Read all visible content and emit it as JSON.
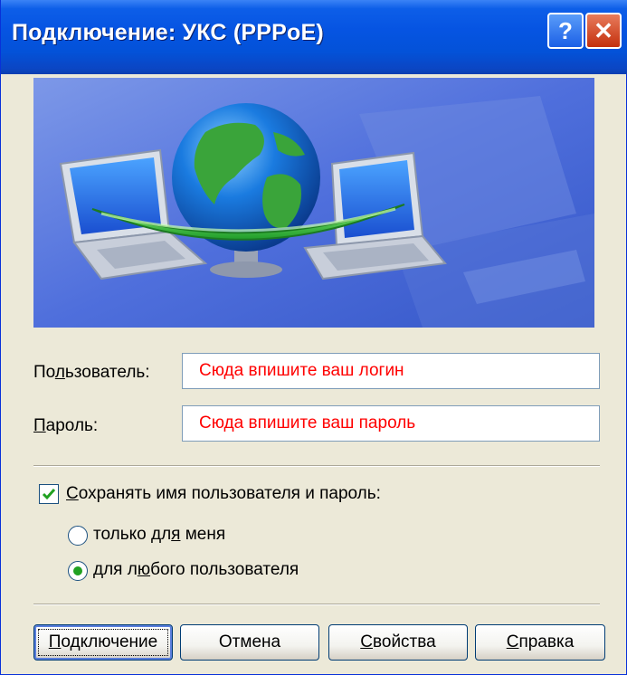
{
  "window": {
    "title": "Подключение: УКС (PPPoE)",
    "help_glyph": "?",
    "close_glyph": "✕"
  },
  "form": {
    "user_label_prefix": "По",
    "user_label_key": "л",
    "user_label_rest": "ьзователь:",
    "user_value": "Сюда впишите ваш логин",
    "password_label_prefix": "",
    "password_label_key": "П",
    "password_label_rest": "ароль:",
    "password_value": "Сюда впишите ваш пароль"
  },
  "save": {
    "checked": true,
    "label_prefix": "",
    "label_key": "С",
    "label_rest": "охранять имя пользователя и пароль:",
    "options": [
      {
        "prefix": "только дл",
        "key": "я",
        "rest": " меня",
        "selected": false
      },
      {
        "prefix": "для л",
        "key": "ю",
        "rest": "бого пользователя",
        "selected": true
      }
    ]
  },
  "buttons": {
    "connect_key": "П",
    "connect_rest": "одключение",
    "cancel": "Отмена",
    "properties_key": "С",
    "properties_rest": "войства",
    "help_key": "С",
    "help_rest": "правка"
  },
  "colors": {
    "title_bar": "#0654e2",
    "field_text": "#ff0000",
    "dialog_bg": "#ece9d8",
    "radio_dot": "#21a121"
  },
  "icons": {
    "banner": "globe-network-laptops-icon",
    "check": "checkmark-icon"
  }
}
